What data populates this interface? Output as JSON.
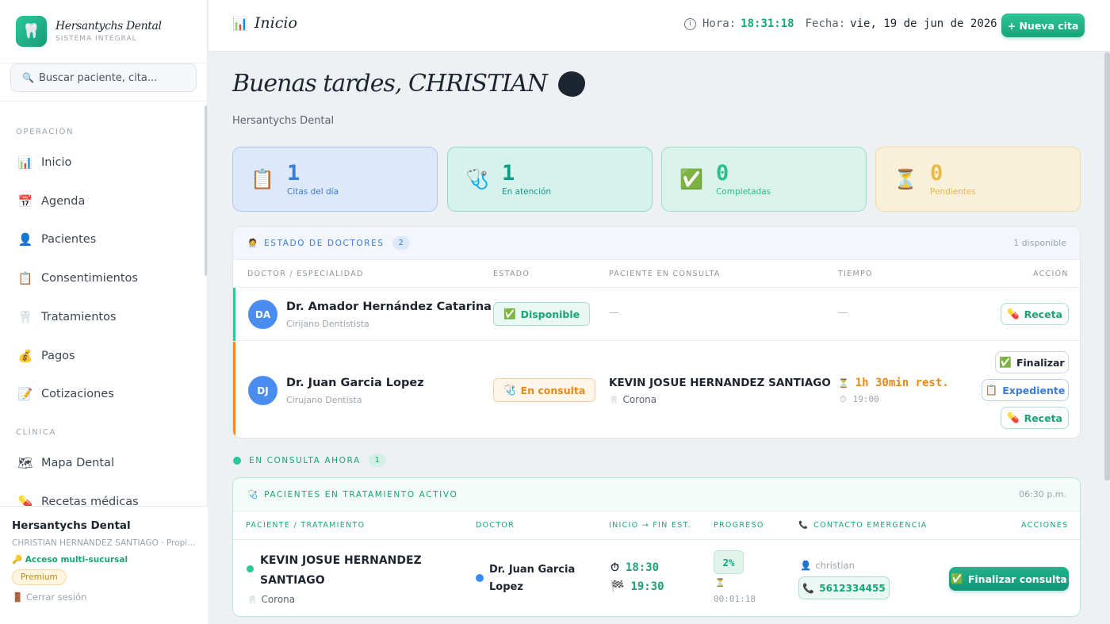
{
  "brand": {
    "name": "Hersantychs Dental",
    "subtitle": "SISTEMA INTEGRAL",
    "logo_icon": "tooth-icon"
  },
  "search": {
    "placeholder": "Buscar paciente, cita..."
  },
  "nav": {
    "section_operacion": "OPERACIÓN",
    "section_clinica": "CLÍNICA",
    "items": [
      {
        "label": "Inicio",
        "icon": "📊"
      },
      {
        "label": "Agenda",
        "icon": "📅"
      },
      {
        "label": "Pacientes",
        "icon": "👤"
      },
      {
        "label": "Consentimientos",
        "icon": "📋"
      },
      {
        "label": "Tratamientos",
        "icon": "🦷"
      },
      {
        "label": "Pagos",
        "icon": "💰"
      },
      {
        "label": "Cotizaciones",
        "icon": "📝"
      },
      {
        "label": "Mapa Dental",
        "icon": "🗺"
      },
      {
        "label": "Recetas médicas",
        "icon": "💊"
      }
    ]
  },
  "footer": {
    "org": "Hersantychs Dental",
    "user": "CHRISTIAN HERNÁNDEZ SANTIAGO · Propi...",
    "access": "🔑 Acceso multi-sucursal",
    "plan": "Premium",
    "logout": "Cerrar sesión"
  },
  "topbar": {
    "title": "Inicio",
    "time_label": "Hora:",
    "time": "18:31:18",
    "date_label": "Fecha:",
    "date": "vie, 19 de jun de 2026",
    "new_button": "+ Nueva cita"
  },
  "greeting": {
    "title": "Buenas tardes, CHRISTIAN",
    "subtitle": "Hersantychs Dental"
  },
  "stats": [
    {
      "value": "1",
      "label": "Citas del día",
      "icon": "📋"
    },
    {
      "value": "1",
      "label": "En atención",
      "icon": "🩺"
    },
    {
      "value": "0",
      "label": "Completadas",
      "icon": "✅"
    },
    {
      "value": "0",
      "label": "Pendientes",
      "icon": "⏳"
    }
  ],
  "doctors": {
    "title": "ESTADO DE DOCTORES",
    "count": "2",
    "available_text": "1 disponible",
    "headers": [
      "DOCTOR / ESPECIALIDAD",
      "ESTADO",
      "PACIENTE EN CONSULTA",
      "TIEMPO",
      "ACCIÓN"
    ],
    "rows": [
      {
        "initials": "DA",
        "name": "Dr. Amador Hernández Catarina",
        "specialty": "Cirijano Dentistista",
        "status": "Disponible",
        "patient": "—",
        "time": "—",
        "actions": [
          "Receta"
        ]
      },
      {
        "initials": "DJ",
        "name": "Dr. Juan Garcia Lopez",
        "specialty": "Cirujano Dentista",
        "status": "En consulta",
        "patient": "KEVIN JOSUE HERNANDEZ SANTIAGO",
        "treatment": "Corona",
        "time_remaining": "1h 30min rest.",
        "time_end": "19:00",
        "actions": [
          "Finalizar",
          "Expediente",
          "Receta"
        ]
      }
    ]
  },
  "in_consult": {
    "label": "EN CONSULTA AHORA",
    "count": "1"
  },
  "active": {
    "title": "PACIENTES EN TRATAMIENTO ACTIVO",
    "time": "06:30 p.m.",
    "headers": [
      "PACIENTE / TRATAMIENTO",
      "DOCTOR",
      "INICIO → FIN EST.",
      "PROGRESO",
      "CONTACTO EMERGENCIA",
      "ACCIONES"
    ],
    "row": {
      "patient_line1": "KEVIN JOSUE HERNANDEZ",
      "patient_line2": "SANTIAGO",
      "treatment": "Corona",
      "doctor_line1": "Dr. Juan Garcia",
      "doctor_line2": "Lopez",
      "start": "18:30",
      "end": "19:30",
      "progress": "2%",
      "elapsed": "00:01:18",
      "contact_name": "christian",
      "contact_phone": "5612334455",
      "action": "Finalizar consulta"
    }
  },
  "colors": {
    "accent": "#18a477",
    "blue": "#3a7bd5",
    "orange": "#e8891a"
  }
}
